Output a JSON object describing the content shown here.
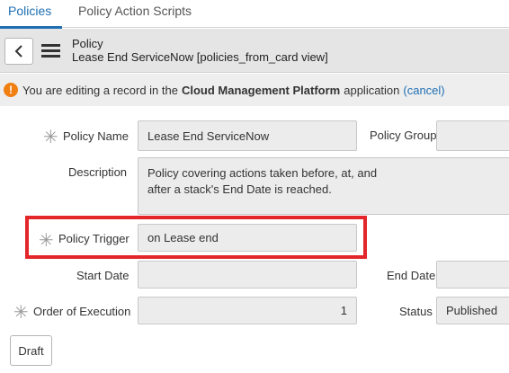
{
  "tabs": [
    {
      "label": "Policies",
      "active": true
    },
    {
      "label": "Policy Action Scripts",
      "active": false
    }
  ],
  "header": {
    "title": "Policy",
    "subtitle": "Lease End ServiceNow [policies_from_card view]"
  },
  "notice": {
    "prefix": "You are editing a record in the",
    "app_name": "Cloud Management Platform",
    "suffix": "application",
    "cancel_label": "(cancel)"
  },
  "form": {
    "policy_name_label": "Policy Name",
    "policy_name_value": "Lease End ServiceNow",
    "policy_group_label": "Policy Group",
    "policy_group_value": "",
    "description_label": "Description",
    "description_value": "Policy covering actions taken before, at, and\nafter a stack's End Date is reached.",
    "policy_trigger_label": "Policy Trigger",
    "policy_trigger_value": "on Lease end",
    "start_date_label": "Start Date",
    "start_date_value": "",
    "end_date_label": "End Date",
    "end_date_value": "",
    "order_label": "Order of Execution",
    "order_value": "1",
    "status_label": "Status",
    "status_value": "Published",
    "required_mark": "✳"
  },
  "buttons": {
    "draft_label": "Draft"
  },
  "colors": {
    "accent": "#1f6fb2",
    "highlight": "#e2262a",
    "warning": "#f07f14"
  }
}
